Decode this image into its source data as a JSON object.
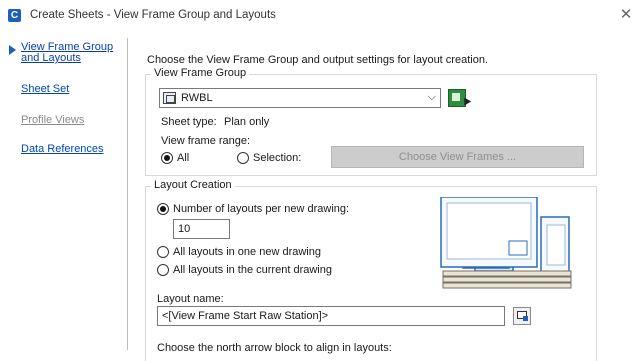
{
  "window": {
    "app_icon_letter": "C",
    "title": "Create Sheets - View Frame Group and Layouts",
    "close_symbol": "✕"
  },
  "sidebar": {
    "items": [
      {
        "label": "View Frame Group and Layouts",
        "state": "active"
      },
      {
        "label": "Sheet Set",
        "state": "enabled"
      },
      {
        "label": "Profile Views",
        "state": "disabled"
      },
      {
        "label": "Data References",
        "state": "enabled"
      }
    ]
  },
  "main": {
    "intro": "Choose the View Frame Group and output settings for layout creation.",
    "view_frame_group": {
      "legend": "View Frame Group",
      "selected": "RWBL",
      "sheet_type_label": "Sheet type:",
      "sheet_type_value": "Plan only",
      "range_label": "View frame range:",
      "range_all": "All",
      "range_selection": "Selection:",
      "range_selected": "All",
      "choose_frames_button": "Choose View Frames ..."
    },
    "layout_creation": {
      "legend": "Layout Creation",
      "option_per_drawing": "Number of layouts per new drawing:",
      "per_drawing_value": "10",
      "option_one_drawing": "All layouts in one new drawing",
      "option_current_drawing": "All layouts in the current drawing",
      "selected_option": "Number of layouts per new drawing:",
      "layout_name_label": "Layout name:",
      "layout_name_value": "<[View Frame Start Raw Station]>",
      "north_arrow_label": "Choose the north arrow block to align in layouts:"
    }
  },
  "colors": {
    "link": "#0047b3",
    "accent": "#1f5fb8",
    "disabled_text": "#8a8a8a",
    "pick_green": "#2f8f3f"
  },
  "icons": {
    "app": "civil3d-icon",
    "close": "close-icon",
    "nav_pointer": "nav-arrow-icon",
    "view_frame_group": "view-frame-group-icon",
    "dropdown": "chevron-down-icon",
    "pick_from_drawing": "pick-from-drawing-icon",
    "layout_name_editor": "edit-name-format-icon",
    "layouts_illustration": "layouts-stack-illustration"
  }
}
